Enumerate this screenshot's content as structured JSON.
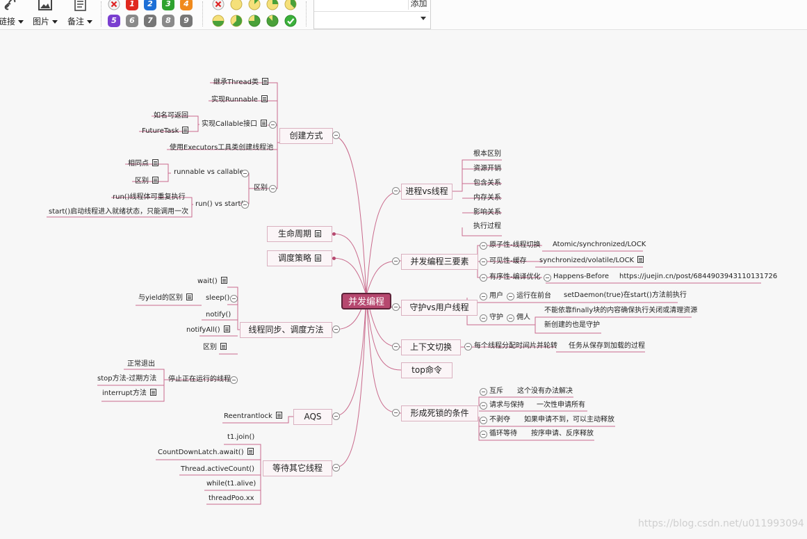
{
  "toolbar": {
    "link_label": "链接",
    "image_label": "图片",
    "note_label": "备注",
    "priority_icons": [
      "1",
      "2",
      "3",
      "4",
      "5",
      "6",
      "7",
      "8",
      "9"
    ],
    "progress_icons": [
      "progress-none",
      "progress-0",
      "progress-1-8",
      "progress-1-4",
      "progress-3-8",
      "progress-1-2",
      "progress-5-8",
      "progress-3-4",
      "progress-7-8",
      "progress-done"
    ],
    "search_placeholder": "",
    "add_label": "添加",
    "select_value": ""
  },
  "mindmap": {
    "root": "并发编程",
    "left": {
      "create": {
        "label": "创建方式",
        "items": [
          "继承Thread类",
          "实现Runnable",
          "实现Callable接口",
          "如名可返回",
          "FutureTask",
          "使用Executors工具类创建线程池"
        ],
        "diff": "区别",
        "diff_items": [
          "runnable vs callable",
          "相同点",
          "区别",
          "run() vs start()",
          "run()线程体可重复执行",
          "start()启动线程进入就绪状态，只能调用一次"
        ]
      },
      "lifecycle": "生命周期",
      "schedule": "调度策略",
      "sync": {
        "label": "线程同步、调度方法",
        "items": [
          "wait()",
          "sleep()",
          "与yield的区别",
          "notify()",
          "notifyAll()",
          "区别",
          "停止正在运行的线程",
          "正常退出",
          "stop方法-过期方法",
          "interrupt方法"
        ]
      },
      "aqs": {
        "label": "AQS",
        "items": [
          "Reentrantlock"
        ]
      },
      "wait_others": {
        "label": "等待其它线程",
        "items": [
          "t1.join()",
          "CountDownLatch.await()",
          "Thread.activeCount()",
          "while(t1.alive)",
          "threadPoo.xx"
        ]
      }
    },
    "right": {
      "process": {
        "label": "进程vs线程",
        "items": [
          "根本区别",
          "资源开销",
          "包含关系",
          "内存关系",
          "影响关系",
          "执行过程"
        ]
      },
      "three": {
        "label": "并发编程三要素",
        "items": [
          "原子性-线程切换",
          "Atomic/synchronized/LOCK",
          "可见性-缓存",
          "synchronized/volatile/LOCK",
          "有序性-编译优化",
          "Happens-Before",
          "https://juejin.cn/post/6844903943110131726"
        ]
      },
      "daemon": {
        "label": "守护vs用户线程",
        "items": [
          "用户",
          "运行在前台",
          "setDaemon(true)在start()方法前执行",
          "守护",
          "佣人",
          "不能依靠finally块的内容确保执行关闭或清理资源",
          "新创建的也是守护"
        ]
      },
      "context": {
        "label": "上下文切换",
        "items": [
          "每个线程分配时间片并轮转",
          "任务从保存到加载的过程"
        ]
      },
      "top": "top命令",
      "deadlock": {
        "label": "形成死锁的条件",
        "items": [
          "互斥",
          "这个没有办法解决",
          "请求与保持",
          "一次性申请所有",
          "不剥夺",
          "如果申请不到，可以主动释放",
          "循环等待",
          "按序申请、反序释放"
        ]
      }
    }
  },
  "watermark": "https://blog.csdn.net/u011993094",
  "colors": {
    "accent": "#b6486f",
    "branch": "#c96a8c",
    "node_border": "#d9b0bf",
    "node_bg": "#fbf5f7"
  }
}
